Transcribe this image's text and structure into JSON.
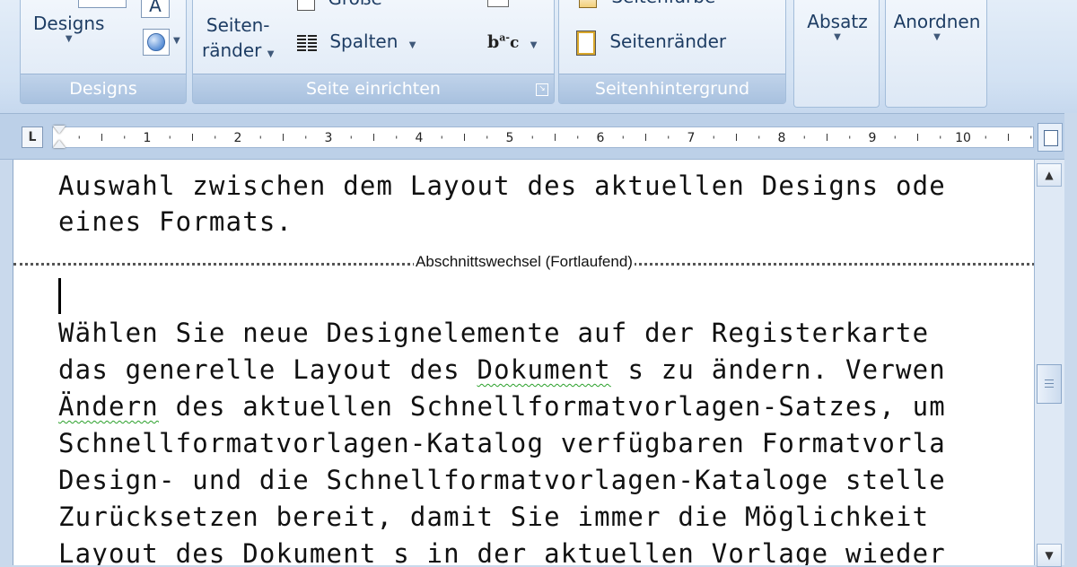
{
  "ribbon": {
    "designs_group": {
      "designs_button": "Designs",
      "label": "Designs"
    },
    "page_setup_group": {
      "margins_button_line1": "Seiten-",
      "margins_button_line2": "ränder",
      "size_button": "Größe",
      "columns_button": "Spalten",
      "label": "Seite einrichten"
    },
    "page_background_group": {
      "page_color_button": "Seitenfarbe",
      "page_borders_button": "Seitenränder",
      "label": "Seitenhintergrund"
    },
    "paragraph_group": {
      "button": "Absatz"
    },
    "arrange_group": {
      "button": "Anordnen"
    }
  },
  "ruler": {
    "numbers": [
      "1",
      "2",
      "3",
      "4",
      "5",
      "6",
      "7",
      "8",
      "9",
      "10"
    ]
  },
  "document": {
    "section_a": [
      "Auswahl zwischen dem Layout des aktuellen Designs ode",
      "eines Formats."
    ],
    "section_break_label": "Abschnittswechsel (Fortlaufend)",
    "section_b": {
      "line1": "Wählen Sie neue Designelemente auf der Registerkarte",
      "line2_pre": "das generelle Layout des ",
      "line2_err": "Dokument",
      "line2_post": " s zu ändern. Verwen",
      "line3_err": "Ändern",
      "line3_post": " des aktuellen Schnellformatvorlagen-Satzes, um",
      "line4": "Schnellformatvorlagen-Katalog verfügbaren Formatvorla",
      "line5": "Design- und die Schnellformatvorlagen-Kataloge stelle",
      "line6": "Zurücksetzen bereit, damit Sie immer die Möglichkeit",
      "line7": "Layout des Dokument s in der aktuellen Vorlage wieder"
    }
  },
  "colors": {
    "ribbon_text": "#1e3d64",
    "group_label_bg": "#a8c1df",
    "spell_underline": "#2aa02a"
  }
}
